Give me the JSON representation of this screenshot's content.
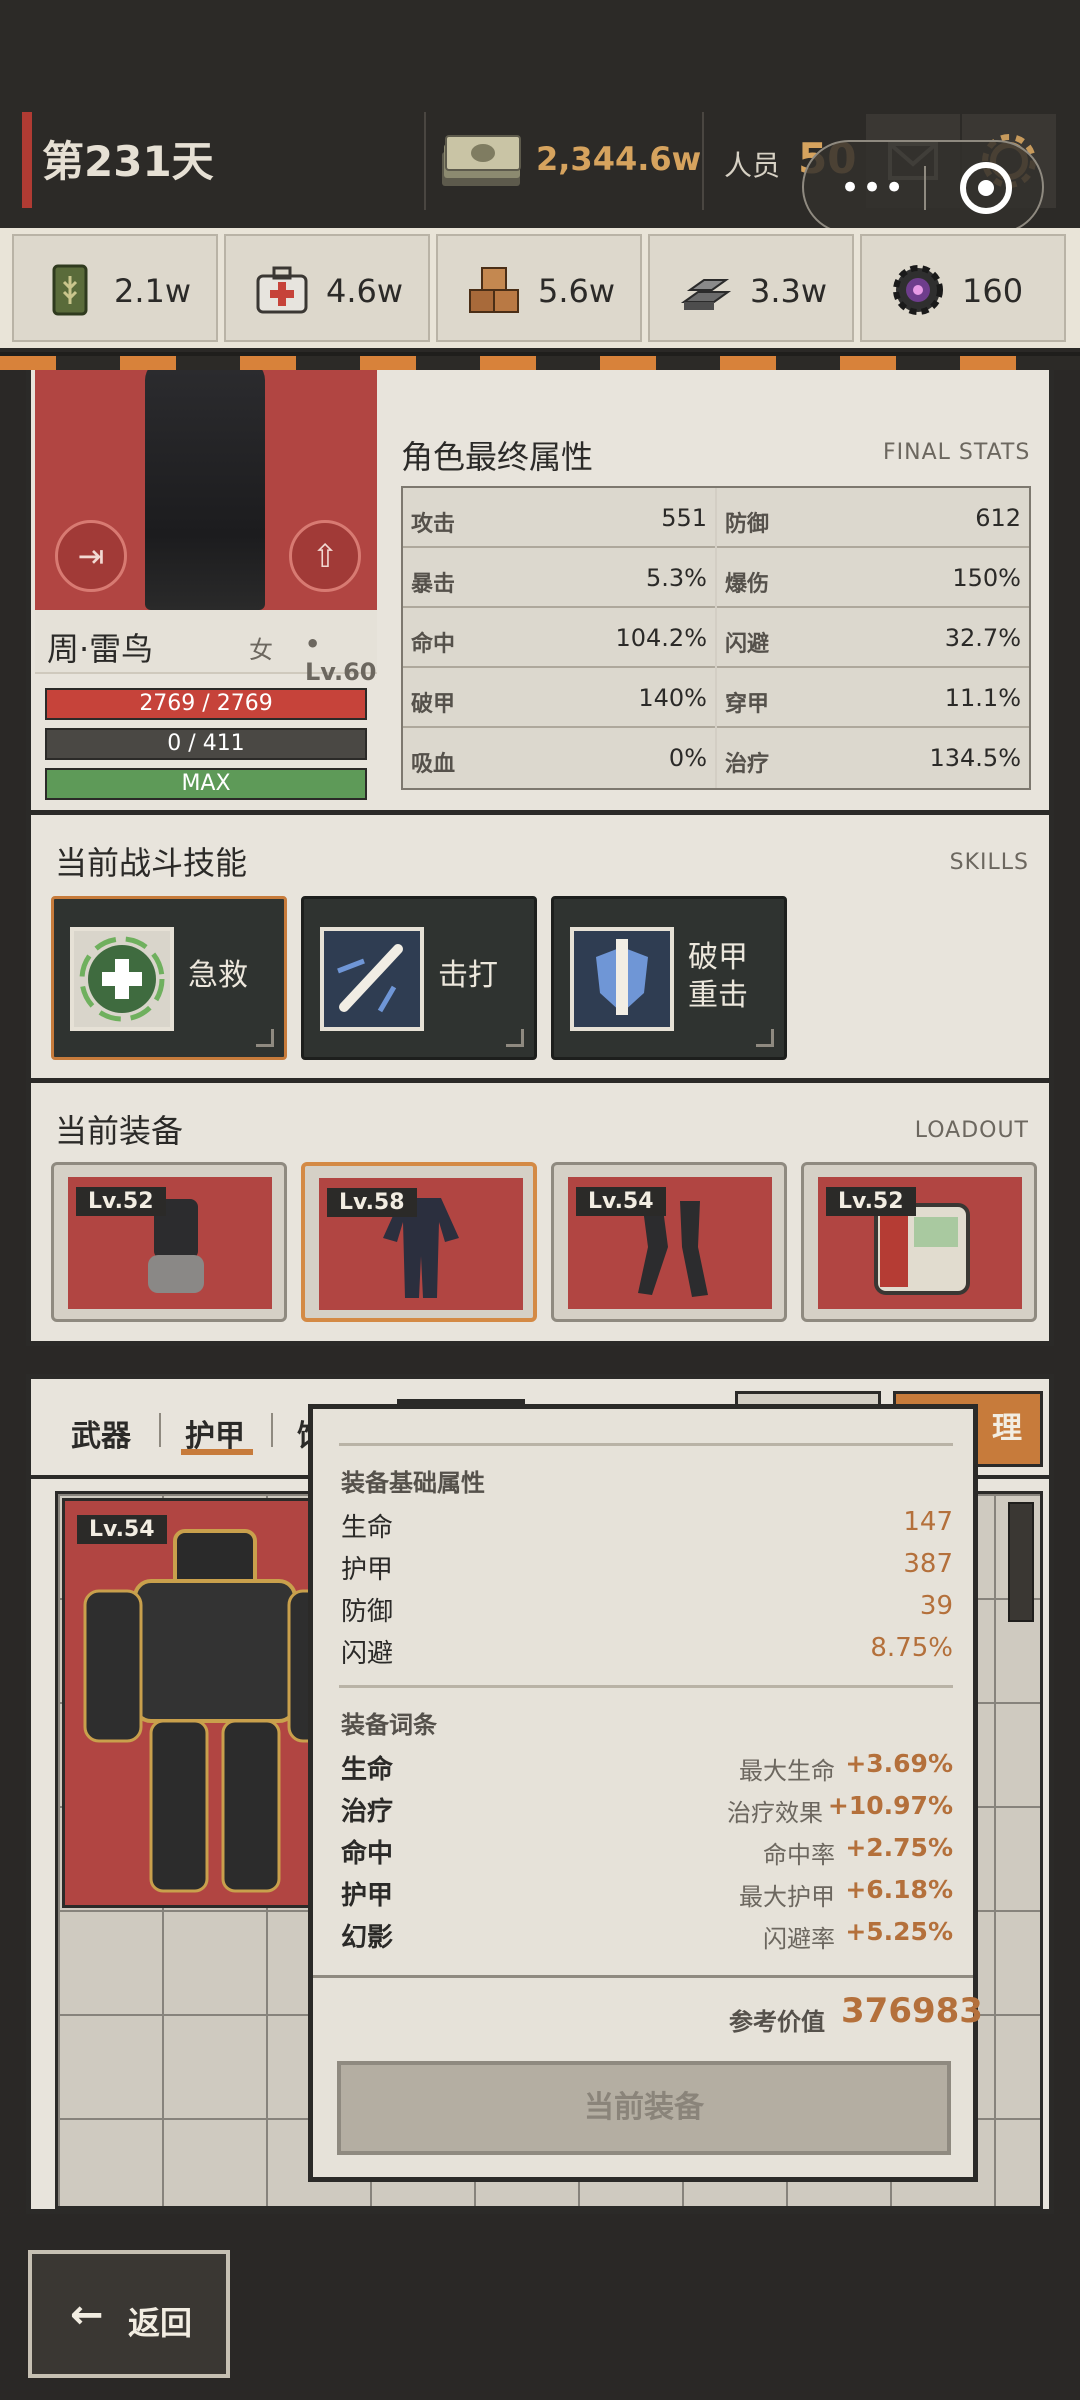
{
  "header": {
    "day": "第231天",
    "cash": "2,344.6w",
    "staff_label": "人员",
    "staff_count": "50"
  },
  "resources": [
    {
      "icon": "ammo-can-icon",
      "value": "2.1w"
    },
    {
      "icon": "medkit-icon",
      "value": "4.6w"
    },
    {
      "icon": "supply-crates-icon",
      "value": "5.6w"
    },
    {
      "icon": "metal-bars-icon",
      "value": "3.3w"
    },
    {
      "icon": "gear-core-icon",
      "value": "160"
    }
  ],
  "character": {
    "name": "周·雷鸟",
    "gender": "女",
    "level": "• Lv.60",
    "hp": "2769 / 2769",
    "armor": "0 / 411",
    "energy": "MAX"
  },
  "final_stats": {
    "title": "角色最终属性",
    "en": "FINAL STATS",
    "rows": [
      {
        "k": "攻击",
        "v": "551"
      },
      {
        "k": "防御",
        "v": "612"
      },
      {
        "k": "暴击",
        "v": "5.3%"
      },
      {
        "k": "爆伤",
        "v": "150%"
      },
      {
        "k": "命中",
        "v": "104.2%"
      },
      {
        "k": "闪避",
        "v": "32.7%"
      },
      {
        "k": "破甲",
        "v": "140%"
      },
      {
        "k": "穿甲",
        "v": "11.1%"
      },
      {
        "k": "吸血",
        "v": "0%"
      },
      {
        "k": "治疗",
        "v": "134.5%"
      }
    ]
  },
  "skills": {
    "title": "当前战斗技能",
    "en": "SKILLS",
    "items": [
      {
        "label": "急救",
        "icon": "first-aid-cross-icon"
      },
      {
        "label": "击打",
        "icon": "baton-strike-icon"
      },
      {
        "label": "破甲\n重击",
        "icon": "armor-break-icon"
      }
    ]
  },
  "loadout": {
    "title": "当前装备",
    "en": "LOADOUT",
    "items": [
      {
        "level": "Lv.52",
        "icon": "gauntlet-icon"
      },
      {
        "level": "Lv.58",
        "icon": "bodysuit-icon"
      },
      {
        "level": "Lv.54",
        "icon": "leg-exoskeleton-icon"
      },
      {
        "level": "Lv.52",
        "icon": "backpack-device-icon"
      }
    ]
  },
  "inventory": {
    "tabs": [
      "武器",
      "护甲",
      "饰"
    ],
    "manage_label": "理",
    "selected_item_level": "Lv.54"
  },
  "tooltip": {
    "base_title": "装备基础属性",
    "base": [
      {
        "k": "生命",
        "v": "147"
      },
      {
        "k": "护甲",
        "v": "387"
      },
      {
        "k": "防御",
        "v": "39"
      },
      {
        "k": "闪避",
        "v": "8.75%"
      }
    ],
    "affix_title": "装备词条",
    "affixes": [
      {
        "k": "生命",
        "d": "最大生命",
        "v": "+3.69%"
      },
      {
        "k": "治疗",
        "d": "治疗效果",
        "v": "+10.97%"
      },
      {
        "k": "命中",
        "d": "命中率",
        "v": "+2.75%"
      },
      {
        "k": "护甲",
        "d": "最大护甲",
        "v": "+6.18%"
      },
      {
        "k": "幻影",
        "d": "闪避率",
        "v": "+5.25%"
      }
    ],
    "ref_label": "参考价值",
    "ref_value": "376983",
    "button": "当前装备"
  },
  "footer": {
    "back": "返回"
  },
  "colors": {
    "accent": "#c77b3b",
    "red_panel": "#b14542",
    "hp": "#c6433a",
    "energy": "#5e9a58"
  }
}
